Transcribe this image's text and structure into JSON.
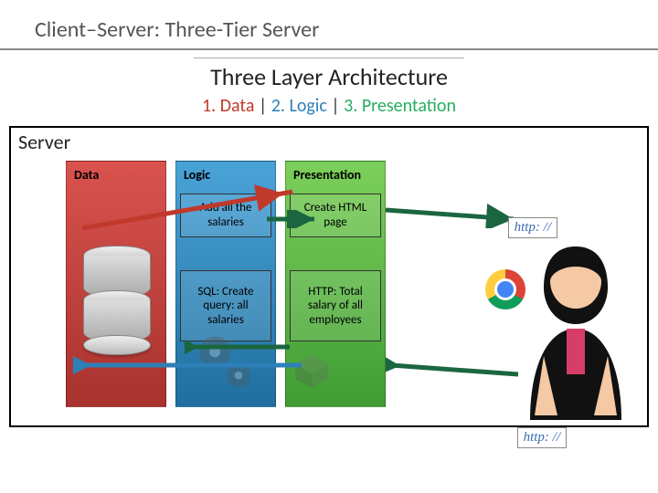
{
  "title": "Client–Server: Three-Tier Server",
  "subtitle": "Three Layer Architecture",
  "layers": {
    "p1": "1. Data",
    "p2": "2. Logic",
    "p3": "3. Presentation",
    "sep": " | "
  },
  "server_label": "Server",
  "columns": {
    "data": {
      "title": "Data"
    },
    "logic": {
      "title": "Logic",
      "box1": "Add all the salaries",
      "box2": "SQL:\nCreate query:\nall salaries"
    },
    "presentation": {
      "title": "Presentation",
      "box1": "Create HTML page",
      "box2": "HTTP:\nTotal salary of all employees"
    }
  },
  "http_label": "http: //"
}
